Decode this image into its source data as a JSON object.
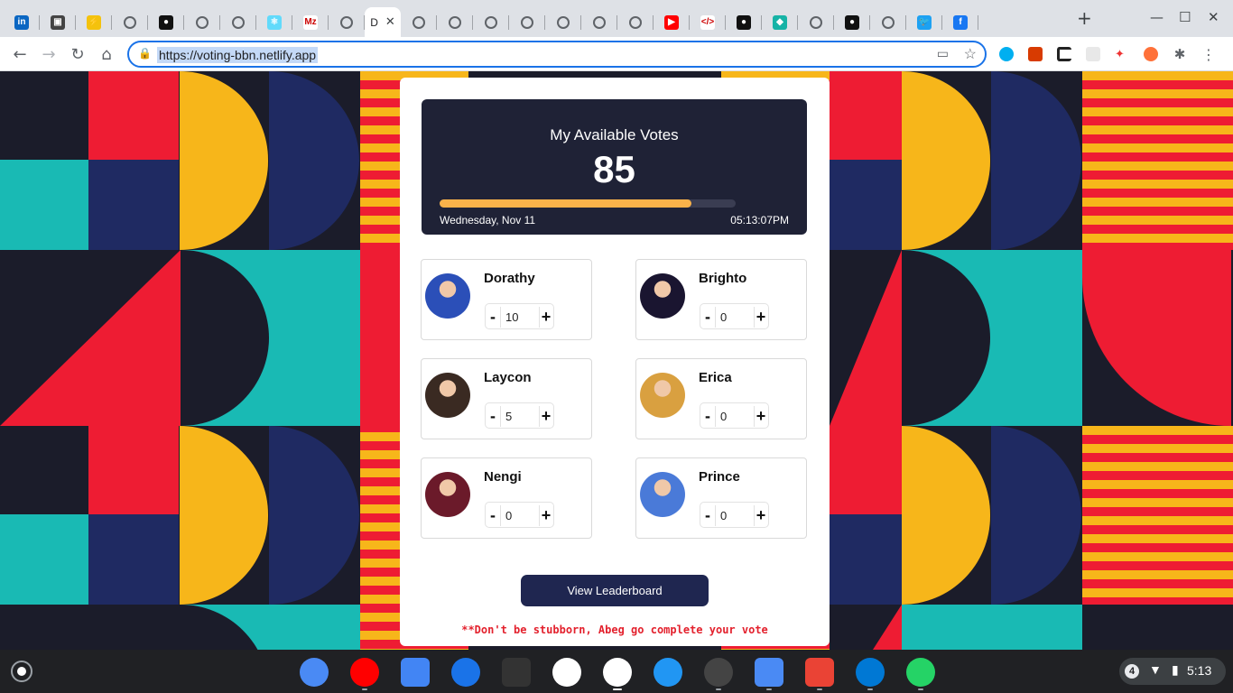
{
  "browser": {
    "active_tab_title": "D",
    "url": "https://voting-bbn.netlify.app",
    "tabs": [
      {
        "icon": "linkedin-icon",
        "color": "#0a66c2",
        "glyph": "in"
      },
      {
        "icon": "briefcase-icon",
        "color": "#444",
        "glyph": "▣"
      },
      {
        "icon": "app-icon",
        "color": "#f4c20d",
        "glyph": "⚡"
      },
      {
        "icon": "globe-icon"
      },
      {
        "icon": "github-icon",
        "color": "#111",
        "glyph": "●"
      },
      {
        "icon": "globe-icon"
      },
      {
        "icon": "globe-icon"
      },
      {
        "icon": "react-icon",
        "color": "#61dafb",
        "glyph": "⚛"
      },
      {
        "icon": "mz-icon",
        "color": "#fff",
        "glyph": "Mz"
      },
      {
        "icon": "globe-icon"
      },
      {
        "icon": "active"
      },
      {
        "icon": "globe-icon"
      },
      {
        "icon": "globe-icon"
      },
      {
        "icon": "globe-icon"
      },
      {
        "icon": "globe-icon"
      },
      {
        "icon": "globe-icon"
      },
      {
        "icon": "globe-icon"
      },
      {
        "icon": "globe-icon"
      },
      {
        "icon": "youtube-icon",
        "color": "#ff0000",
        "glyph": "▶"
      },
      {
        "icon": "code-icon",
        "color": "#fff",
        "glyph": "</>"
      },
      {
        "icon": "github-icon",
        "color": "#111",
        "glyph": "●"
      },
      {
        "icon": "diamond-icon",
        "color": "#16b3a6",
        "glyph": "◆"
      },
      {
        "icon": "globe-icon"
      },
      {
        "icon": "github-icon",
        "color": "#111",
        "glyph": "●"
      },
      {
        "icon": "globe-icon"
      },
      {
        "icon": "twitter-icon",
        "color": "#1da1f2",
        "glyph": "🐦"
      },
      {
        "icon": "facebook-icon",
        "color": "#1877f2",
        "glyph": "f"
      }
    ]
  },
  "votes": {
    "title": "My Available Votes",
    "count": "85",
    "progress": 0.85,
    "date": "Wednesday, Nov 11",
    "time": "05:13:07PM"
  },
  "candidates": [
    {
      "name": "Dorathy",
      "votes": "10",
      "avatar_color": "#2b4fb8"
    },
    {
      "name": "Brighto",
      "votes": "0",
      "avatar_color": "#1a1530"
    },
    {
      "name": "Laycon",
      "votes": "5",
      "avatar_color": "#3a2a22"
    },
    {
      "name": "Erica",
      "votes": "0",
      "avatar_color": "#d9a040"
    },
    {
      "name": "Nengi",
      "votes": "0",
      "avatar_color": "#6b1a2a"
    },
    {
      "name": "Prince",
      "votes": "0",
      "avatar_color": "#4a7ad8"
    }
  ],
  "buttons": {
    "minus": "-",
    "plus": "+",
    "leaderboard": "View Leaderboard"
  },
  "warning": "**Don't be stubborn, Abeg go complete your vote",
  "shelf": {
    "apps": [
      "settings-icon",
      "youtube-icon",
      "docs-icon",
      "messages-icon",
      "text-icon",
      "gmail-icon",
      "chrome-icon",
      "maps-icon",
      "terminal-icon",
      "files-icon",
      "screencast-icon",
      "vscode-icon",
      "whatsapp-icon"
    ],
    "notification_count": "4",
    "clock": "5:13"
  }
}
